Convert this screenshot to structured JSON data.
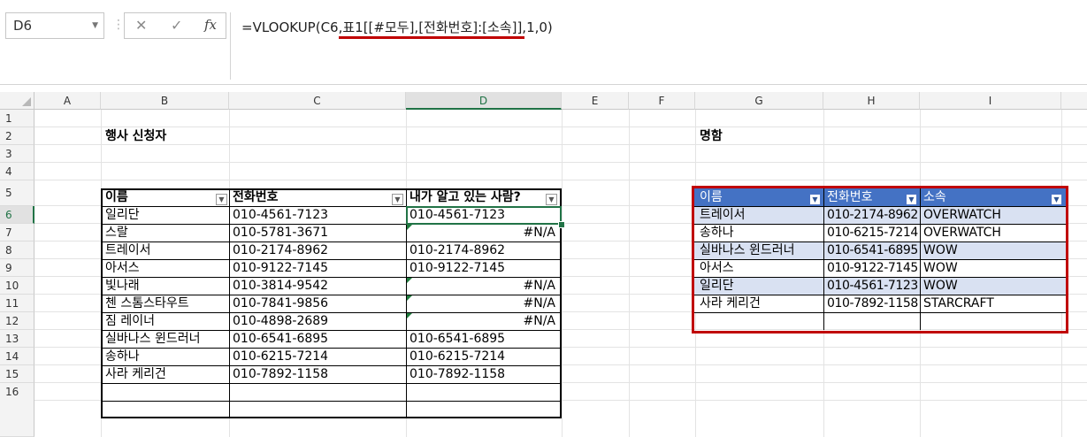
{
  "formula_bar": {
    "name_box": "D6",
    "cancel_glyph": "✕",
    "enter_glyph": "✓",
    "fx_glyph": "fx",
    "formula": "=VLOOKUP(C6,표1[[#모두],[전화번호]:[소속]],1,0)"
  },
  "columns": [
    "A",
    "B",
    "C",
    "D",
    "E",
    "F",
    "G",
    "H",
    "I"
  ],
  "rows": [
    "1",
    "2",
    "3",
    "4",
    "5",
    "6",
    "7",
    "8",
    "9",
    "10",
    "11",
    "12",
    "13",
    "14",
    "15",
    "16"
  ],
  "selected": {
    "column": "D",
    "row": "6"
  },
  "left_section": {
    "title": "행사 신청자",
    "headers": [
      "이름",
      "전화번호",
      "내가 알고 있는 사람?"
    ],
    "rows": [
      [
        "일리단",
        "010-4561-7123",
        "010-4561-7123"
      ],
      [
        "스랄",
        "010-5781-3671",
        "#N/A"
      ],
      [
        "트레이서",
        "010-2174-8962",
        "010-2174-8962"
      ],
      [
        "아서스",
        "010-9122-7145",
        "010-9122-7145"
      ],
      [
        "빛나래",
        "010-3814-9542",
        "#N/A"
      ],
      [
        "첸 스톰스타우트",
        "010-7841-9856",
        "#N/A"
      ],
      [
        "짐 레이너",
        "010-4898-2689",
        "#N/A"
      ],
      [
        "실바나스 윈드러너",
        "010-6541-6895",
        "010-6541-6895"
      ],
      [
        "송하나",
        "010-6215-7214",
        "010-6215-7214"
      ],
      [
        "사라 케리건",
        "010-7892-1158",
        "010-7892-1158"
      ]
    ]
  },
  "right_section": {
    "title": "명함",
    "headers": [
      "이름",
      "전화번호",
      "소속"
    ],
    "rows": [
      [
        "트레이서",
        "010-2174-8962",
        "OVERWATCH"
      ],
      [
        "송하나",
        "010-6215-7214",
        "OVERWATCH"
      ],
      [
        "실바나스 윈드러너",
        "010-6541-6895",
        "WOW"
      ],
      [
        "아서스",
        "010-9122-7145",
        "WOW"
      ],
      [
        "일리단",
        "010-4561-7123",
        "WOW"
      ],
      [
        "사라 케리건",
        "010-7892-1158",
        "STARCRAFT"
      ]
    ]
  },
  "colors": {
    "header_blue": "#4472c4",
    "band_blue": "#d9e1f2",
    "highlight_red": "#c00000",
    "excel_green": "#217346"
  }
}
